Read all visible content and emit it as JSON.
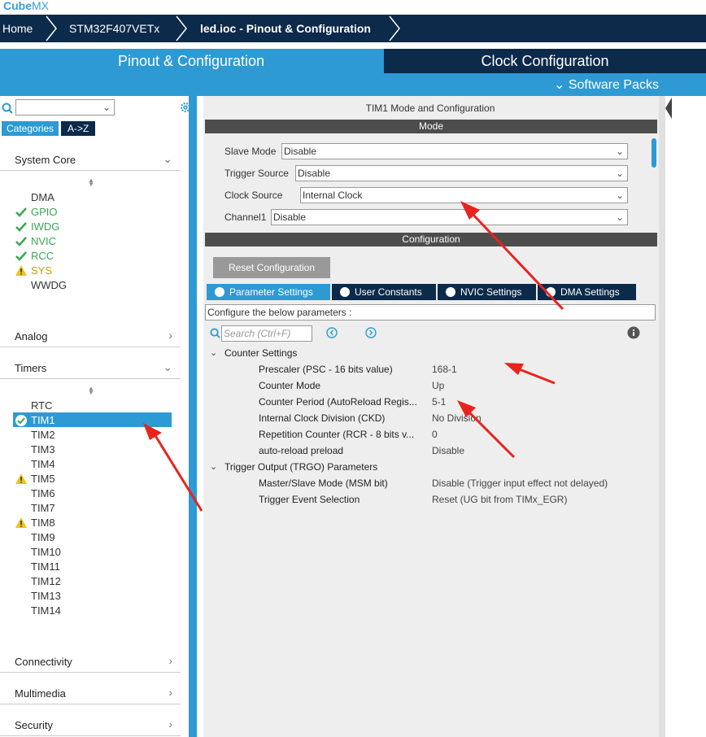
{
  "app": {
    "logo_main": "Cube",
    "logo_accent": "MX"
  },
  "breadcrumb": [
    "Home",
    "STM32F407VETx",
    "led.ioc - Pinout & Configuration"
  ],
  "top_tabs": {
    "pinout": "Pinout & Configuration",
    "clock": "Clock Configuration",
    "software_packs": "Software Packs"
  },
  "left_panel": {
    "search_value": "",
    "category_tabs": [
      "Categories",
      "A->Z"
    ],
    "sections": {
      "system_core": "System Core",
      "analog": "Analog",
      "timers": "Timers",
      "connectivity": "Connectivity",
      "multimedia": "Multimedia",
      "security": "Security"
    },
    "system_core_items": [
      {
        "label": "DMA",
        "status": "none"
      },
      {
        "label": "GPIO",
        "status": "ok"
      },
      {
        "label": "IWDG",
        "status": "ok"
      },
      {
        "label": "NVIC",
        "status": "ok"
      },
      {
        "label": "RCC",
        "status": "ok"
      },
      {
        "label": "SYS",
        "status": "warning"
      },
      {
        "label": "WWDG",
        "status": "none"
      }
    ],
    "timer_items": [
      {
        "label": "RTC",
        "status": "none"
      },
      {
        "label": "TIM1",
        "status": "selected"
      },
      {
        "label": "TIM2",
        "status": "none"
      },
      {
        "label": "TIM3",
        "status": "none"
      },
      {
        "label": "TIM4",
        "status": "none"
      },
      {
        "label": "TIM5",
        "status": "warning"
      },
      {
        "label": "TIM6",
        "status": "none"
      },
      {
        "label": "TIM7",
        "status": "none"
      },
      {
        "label": "TIM8",
        "status": "warning"
      },
      {
        "label": "TIM9",
        "status": "none"
      },
      {
        "label": "TIM10",
        "status": "none"
      },
      {
        "label": "TIM11",
        "status": "none"
      },
      {
        "label": "TIM12",
        "status": "none"
      },
      {
        "label": "TIM13",
        "status": "none"
      },
      {
        "label": "TIM14",
        "status": "none"
      }
    ]
  },
  "right_panel": {
    "title": "TIM1 Mode and Configuration",
    "mode_header": "Mode",
    "mode_fields": [
      {
        "label": "Slave Mode",
        "value": "Disable"
      },
      {
        "label": "Trigger Source",
        "value": "Disable"
      },
      {
        "label": "Clock Source",
        "value": "Internal Clock"
      },
      {
        "label": "Channel1",
        "value": "Disable"
      }
    ],
    "config_header": "Configuration",
    "reset_button": "Reset Configuration",
    "param_tabs": [
      "Parameter Settings",
      "User Constants",
      "NVIC Settings",
      "DMA Settings"
    ],
    "configure_text": "Configure the below parameters :",
    "search_placeholder": "Search (Ctrl+F)",
    "groups": [
      {
        "name": "Counter Settings",
        "params": [
          {
            "name": "Prescaler (PSC - 16 bits value)",
            "value": "168-1"
          },
          {
            "name": "Counter Mode",
            "value": "Up"
          },
          {
            "name": "Counter Period (AutoReload Regis...",
            "value": "5-1"
          },
          {
            "name": "Internal Clock Division (CKD)",
            "value": "No Division"
          },
          {
            "name": "Repetition Counter (RCR - 8 bits v...",
            "value": "0"
          },
          {
            "name": "auto-reload preload",
            "value": "Disable"
          }
        ]
      },
      {
        "name": "Trigger Output (TRGO) Parameters",
        "params": [
          {
            "name": "Master/Slave Mode (MSM bit)",
            "value": "Disable (Trigger input effect not delayed)"
          },
          {
            "name": "Trigger Event Selection",
            "value": "Reset (UG bit from TIMx_EGR)"
          }
        ]
      }
    ]
  },
  "colors": {
    "navy": "#0c2a4a",
    "blue": "#2e9ad3",
    "ok_green": "#3aa852",
    "warn_yellow": "#f0c419",
    "annotation_red": "#e8231e"
  }
}
